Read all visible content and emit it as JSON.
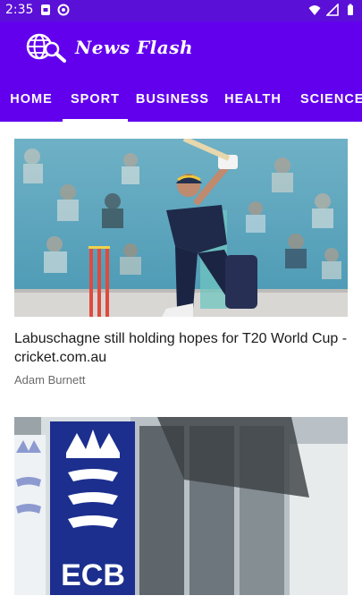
{
  "status_bar": {
    "time": "2:35"
  },
  "app_bar": {
    "title": "News Flash",
    "tabs": [
      {
        "label": "HOME"
      },
      {
        "label": "SPORT"
      },
      {
        "label": "BUSINESS"
      },
      {
        "label": "HEALTH"
      },
      {
        "label": "SCIENCE"
      }
    ],
    "active_tab": "SPORT"
  },
  "articles": [
    {
      "headline": "Labuschagne still holding hopes for T20 World Cup - cricket.com.au",
      "author": "Adam Burnett",
      "image": "cricketer-batting-photo"
    },
    {
      "headline": "",
      "author": "",
      "image": "ecb-crest-building-photo",
      "image_text": "ECB"
    }
  ],
  "colors": {
    "app_bar": "#6200ee",
    "status_bar": "#5a10d6",
    "tab_text": "#ffffff"
  }
}
